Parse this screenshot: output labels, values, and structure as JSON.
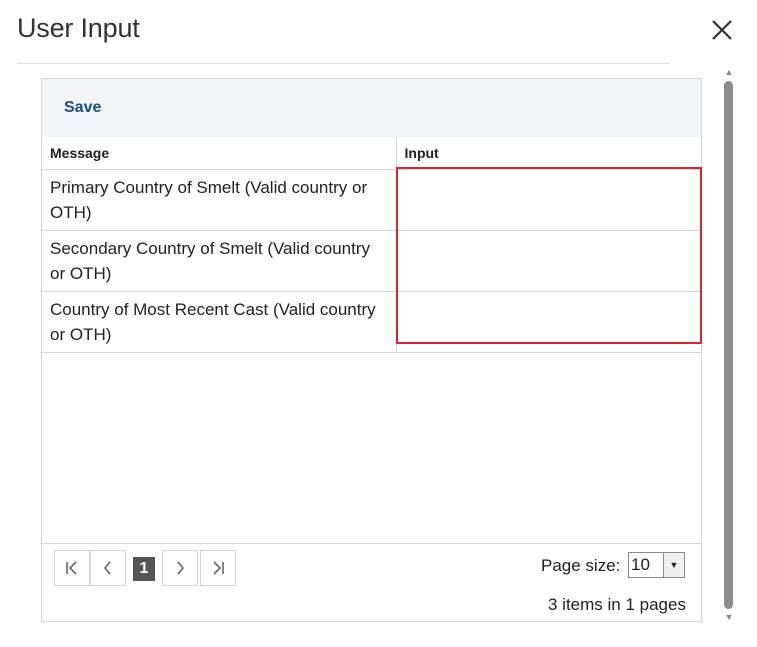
{
  "dialog": {
    "title": "User Input"
  },
  "toolbar": {
    "save_label": "Save"
  },
  "table": {
    "columns": {
      "message": "Message",
      "input": "Input"
    },
    "rows": [
      {
        "message": "Primary Country of Smelt (Valid country or OTH)",
        "input": ""
      },
      {
        "message": "Secondary Country of Smelt (Valid country or OTH)",
        "input": ""
      },
      {
        "message": "Country of Most Recent Cast (Valid country or OTH)",
        "input": ""
      }
    ]
  },
  "pager": {
    "current_page": "1",
    "page_size_label": "Page size:",
    "page_size": "10",
    "items_info": "3 items in 1 pages"
  },
  "colors": {
    "accent": "#1a4e85",
    "highlight": "#d9262f"
  },
  "icons": {
    "close": "close-icon",
    "first": "first-page-icon",
    "prev": "prev-page-icon",
    "next": "next-page-icon",
    "last": "last-page-icon"
  }
}
